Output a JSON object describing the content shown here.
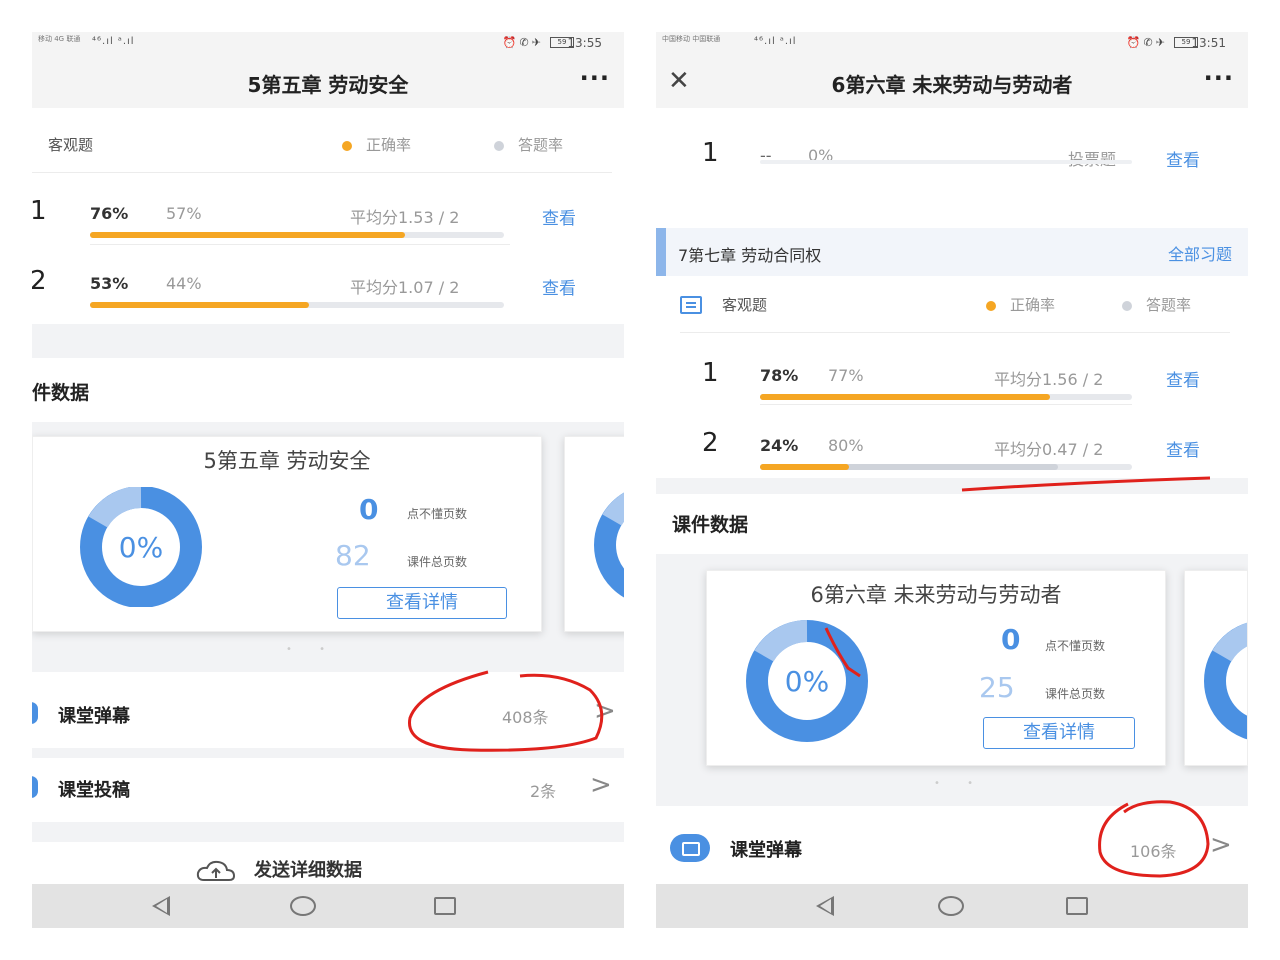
{
  "left": {
    "status": {
      "carrier": "移动 4G 联通",
      "signal": "⁴⁶.ıl ᵃ.ıl",
      "battery": "59",
      "time": "13:55"
    },
    "title": "5第五章 劳动安全",
    "more": "···",
    "objective": {
      "label": "客观题",
      "legend_correct": "正确率",
      "legend_answer": "答题率"
    },
    "questions": [
      {
        "num": "1",
        "correct": "76%",
        "answer": "57%",
        "avg": "平均分1.53 / 2",
        "view": "查看",
        "correct_pct": 76,
        "answer_pct": 57
      },
      {
        "num": "2",
        "correct": "53%",
        "answer": "44%",
        "avg": "平均分1.07 / 2",
        "view": "查看",
        "correct_pct": 53,
        "answer_pct": 44
      }
    ],
    "section_title": "件数据",
    "card": {
      "title": "5第五章 劳动安全",
      "percent": "0%",
      "confused_count": "0",
      "confused_label": "点不懂页数",
      "total_count": "82",
      "total_label": "课件总页数",
      "detail_button": "查看详情"
    },
    "pager": "• •",
    "danmu": {
      "label": "课堂弹幕",
      "count": "408条"
    },
    "tougao": {
      "label": "课堂投稿",
      "count": "2条"
    },
    "send": {
      "label": "发送详细数据"
    }
  },
  "right": {
    "status": {
      "carrier": "中国移动 中国联通",
      "signal": "⁴⁶.ıl ᵃ.ıl",
      "battery": "59",
      "time": "13:51"
    },
    "close": "✕",
    "title": "6第六章 未来劳动与劳动者",
    "more": "···",
    "vote_row": {
      "num": "1",
      "dash": "--",
      "pct": "0%",
      "type": "投票题",
      "view": "查看"
    },
    "chapter": {
      "title": "7第七章 劳动合同权",
      "link": "全部习题"
    },
    "objective": {
      "label": "客观题",
      "legend_correct": "正确率",
      "legend_answer": "答题率"
    },
    "questions": [
      {
        "num": "1",
        "correct": "78%",
        "answer": "77%",
        "avg": "平均分1.56 / 2",
        "view": "查看",
        "correct_pct": 78,
        "answer_pct": 77
      },
      {
        "num": "2",
        "correct": "24%",
        "answer": "80%",
        "avg": "平均分0.47 / 2",
        "view": "查看",
        "correct_pct": 24,
        "answer_pct": 80
      }
    ],
    "section_title": "课件数据",
    "card": {
      "title": "6第六章 未来劳动与劳动者",
      "percent": "0%",
      "confused_count": "0",
      "confused_label": "点不懂页数",
      "total_count": "25",
      "total_label": "课件总页数",
      "detail_button": "查看详情"
    },
    "pager": "• •",
    "danmu": {
      "label": "课堂弹幕",
      "count": "106条"
    }
  },
  "colors": {
    "accent": "#4a90e2",
    "orange": "#f5a623",
    "annotation_red": "#e0211c"
  }
}
